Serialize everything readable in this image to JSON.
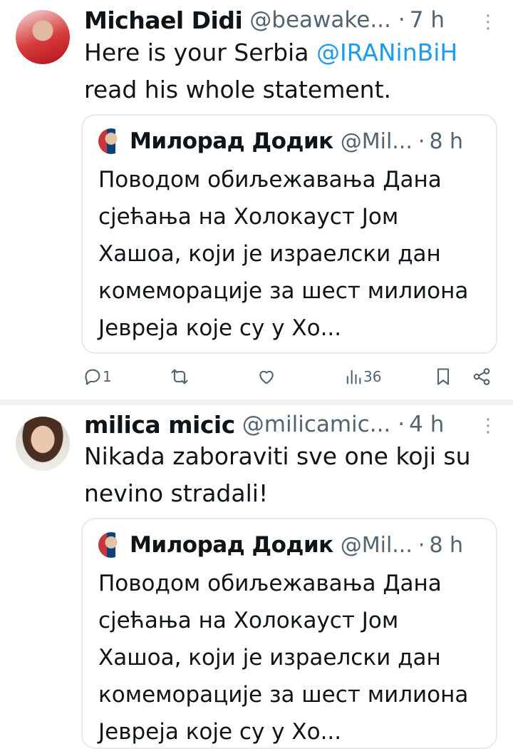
{
  "tweets": [
    {
      "author": "Michael Didi",
      "handle": "@beawake...",
      "separator": "·",
      "time": "7 h",
      "text_before": "Here is your Serbia ",
      "mention": "@IRANinBiH",
      "text_after": " read his whole statement.",
      "quote": {
        "author": "Милорад Додик",
        "handle": "@Mil...",
        "separator": "·",
        "time": "8 h",
        "text": "Поводом обиљежавања Дана сјећања на Холокауст Јом Хашоа, који је израелски дан комеморације за шест милиона Јевреја које су у Хо..."
      },
      "actions": {
        "reply_count": "1",
        "views_count": "36"
      }
    },
    {
      "author": "milica micic",
      "handle": "@milicamic...",
      "separator": "·",
      "time": "4 h",
      "text": "Nikada zaboraviti sve one koji su nevino stradali!",
      "quote": {
        "author": "Милорад Додик",
        "handle": "@Mil...",
        "separator": "·",
        "time": "8 h",
        "text": "Поводом обиљежавања Дана сјећања на Холокауст Јом Хашоа, који је израелски дан комеморације за шест милиона Јевреја које су у Хо..."
      }
    }
  ],
  "icons": {
    "more": "more-vertical-icon",
    "reply": "reply-icon",
    "retweet": "retweet-icon",
    "like": "heart-icon",
    "views": "views-icon",
    "bookmark": "bookmark-icon",
    "share": "share-icon"
  },
  "colors": {
    "mention": "#1d9bf0",
    "secondary_text": "#536471",
    "divider": "#eff3f4"
  }
}
